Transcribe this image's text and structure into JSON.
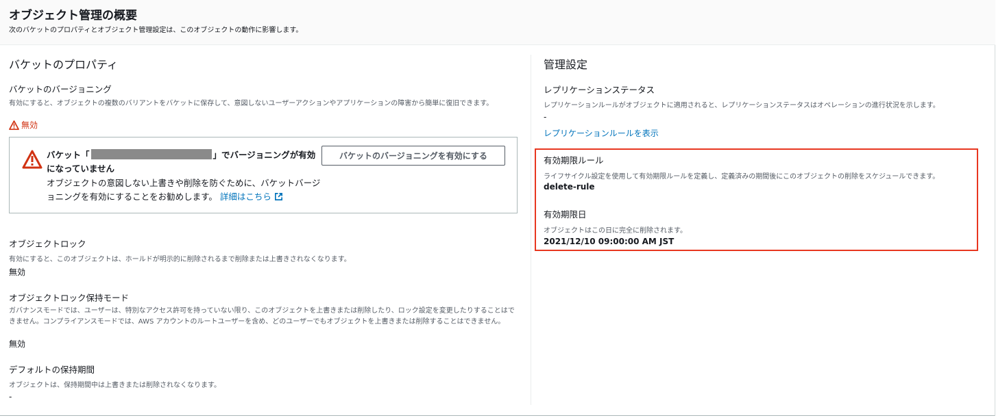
{
  "header": {
    "title": "オブジェクト管理の概要",
    "description": "次のバケットのプロパティとオブジェクト管理設定は、このオブジェクトの動作に影響します。"
  },
  "bucket_properties": {
    "heading": "バケットのプロパティ",
    "versioning": {
      "label": "バケットのバージョニング",
      "description": "有効にすると、オブジェクトの複数のバリアントをバケットに保存して、意図しないユーザーアクションやアプリケーションの障害から簡単に復旧できます。",
      "status": "無効",
      "status_icon": "warning-icon",
      "status_color": "#d13212"
    },
    "alert": {
      "title_prefix": "バケット「",
      "title_suffix": "」でバージョニングが有効になっていません",
      "body": "オブジェクトの意図しない上書きや削除を防ぐために、バケットバージョニングを有効にすることをお勧めします。",
      "link_text": "詳細はこちら",
      "button_label": "バケットのバージョニングを有効にする",
      "icon": "warning-triangle-icon",
      "icon_color": "#d13212"
    },
    "object_lock": {
      "label": "オブジェクトロック",
      "description": "有効にすると、このオブジェクトは、ホールドが明示的に削除されるまで削除または上書きされなくなります。",
      "value": "無効"
    },
    "lock_mode": {
      "label": "オブジェクトロック保持モード",
      "description": "ガバナンスモードでは、ユーザーは、特別なアクセス許可を持っていない限り、このオブジェクトを上書きまたは削除したり、ロック設定を変更したりすることはできません。コンプライアンスモードでは、AWS アカウントのルートユーザーを含め、どのユーザーでもオブジェクトを上書きまたは削除することはできません。",
      "value": "無効"
    },
    "retention_period": {
      "label": "デフォルトの保持期間",
      "description": "オブジェクトは、保持期間中は上書きまたは削除されなくなります。",
      "value": "-"
    }
  },
  "management": {
    "heading": "管理設定",
    "replication": {
      "label": "レプリケーションステータス",
      "description": "レプリケーションルールがオブジェクトに適用されると、レプリケーションステータスはオペレーションの進行状況を示します。",
      "value": "-",
      "link_text": "レプリケーションルールを表示"
    },
    "expiration_rule": {
      "label": "有効期限ルール",
      "description": "ライフサイクル設定を使用して有効期限ルールを定義し、定義済みの期間後にこのオブジェクトの削除をスケジュールできます。",
      "value": "delete-rule"
    },
    "expiration_date": {
      "label": "有効期限日",
      "description": "オブジェクトはこの日に完全に削除されます。",
      "value": "2021/12/10 09:00:00 AM JST"
    },
    "highlight_color": "#e8361f"
  },
  "colors": {
    "link": "#0073bb",
    "text": "#16191f",
    "secondary_text": "#545b64",
    "border": "#aab7b8"
  }
}
